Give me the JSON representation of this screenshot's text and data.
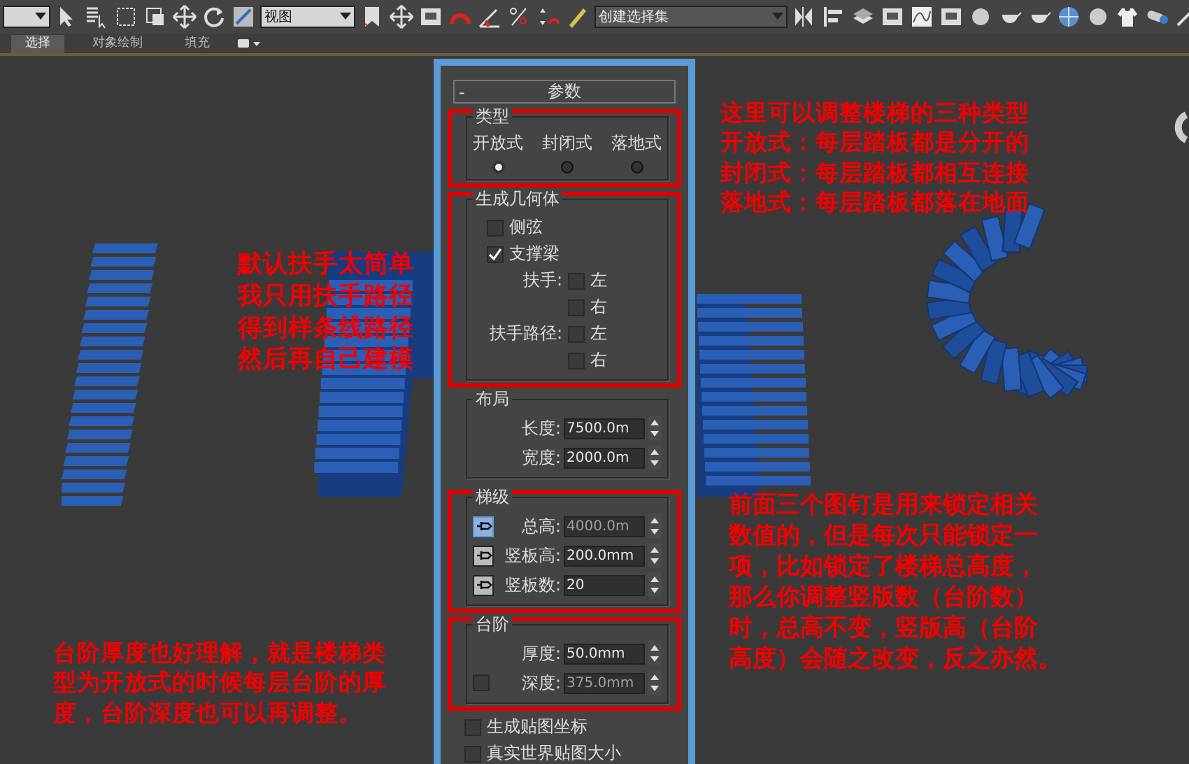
{
  "toolbar": {
    "dropdowns": [
      {
        "value": "视图"
      },
      {
        "value": "创建选择集"
      }
    ]
  },
  "ribbon_tabs": [
    {
      "label": "选择",
      "selected": true
    },
    {
      "label": "对象绘制",
      "selected": false
    },
    {
      "label": "填充",
      "selected": false
    }
  ],
  "parameters_panel": {
    "collapse": "-",
    "title": "参数",
    "type_group": {
      "title": "类型",
      "highlighted": true,
      "options": [
        {
          "label": "开放式",
          "selected": true
        },
        {
          "label": "封闭式",
          "selected": false
        },
        {
          "label": "落地式",
          "selected": false
        }
      ]
    },
    "geometry_group": {
      "title": "生成几何体",
      "highlighted": true,
      "items": [
        {
          "label": "侧弦",
          "checked": false
        },
        {
          "label": "支撑梁",
          "checked": true
        }
      ],
      "rails": [
        {
          "label": "扶手:",
          "options": [
            {
              "label": "左",
              "checked": false
            },
            {
              "label": "右",
              "checked": false
            }
          ]
        },
        {
          "label": "扶手路径:",
          "options": [
            {
              "label": "左",
              "checked": false
            },
            {
              "label": "右",
              "checked": false
            }
          ]
        }
      ]
    },
    "layout_group": {
      "title": "布局",
      "highlighted": false,
      "fields": [
        {
          "label": "长度:",
          "value": "7500.0m",
          "disabled": false
        },
        {
          "label": "宽度:",
          "value": "2000.0m",
          "disabled": false
        }
      ]
    },
    "steps_group": {
      "title": "梯级",
      "highlighted": true,
      "fields": [
        {
          "label": "总高:",
          "value": "4000.0m",
          "disabled": true,
          "pinned": true
        },
        {
          "label": "竖板高:",
          "value": "200.0mm",
          "disabled": false,
          "pinned": false
        },
        {
          "label": "竖板数:",
          "value": "20",
          "disabled": false,
          "pinned": false
        }
      ]
    },
    "treads_group": {
      "title": "台阶",
      "highlighted": true,
      "fields": [
        {
          "label": "厚度:",
          "value": "50.0mm",
          "disabled": false
        },
        {
          "label": "深度:",
          "value": "375.0mm",
          "disabled": true,
          "checked": false
        }
      ]
    },
    "options": [
      {
        "label": "生成贴图坐标",
        "checked": false
      },
      {
        "label": "真实世界贴图大小",
        "checked": false
      }
    ]
  },
  "annotations": [
    {
      "kind": "lines",
      "lines": [
        "这里可以调整楼梯的三种类型",
        "开放式：每层踏板都是分开的",
        "封闭式：每层踏板都相互连接",
        "落地式：每层踏板都落在地面"
      ]
    },
    {
      "kind": "lines",
      "lines": [
        "默认扶手太简单",
        "我只用扶手路径",
        "得到样条线路径",
        "然后再自己建模"
      ]
    },
    {
      "kind": "lines",
      "lines": [
        "前面三个图钉是用来锁定相关",
        "数值的，但是每次只能锁定一",
        "项，比如锁定了楼梯总高度，",
        "那么你调整竖版数（台阶数）",
        "时，总高不变，竖版高（台阶",
        "高度）会随之改变，反之亦然。"
      ]
    },
    {
      "kind": "lines",
      "lines": [
        "台阶厚度也好理解，就是楼梯类",
        "型为开放式的时候每层台阶的厚",
        "度，台阶深度也可以再调整。"
      ]
    }
  ]
}
